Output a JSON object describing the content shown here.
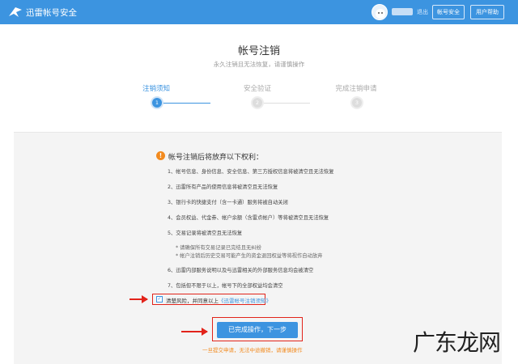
{
  "header": {
    "brand": "迅雷帐号安全",
    "username": "用户",
    "logout": "退出",
    "btn_security": "帐号安全",
    "btn_help": "用户帮助"
  },
  "page": {
    "title": "帐号注销",
    "subtitle": "永久注销且无法恢复，请谨慎操作"
  },
  "steps": [
    {
      "label": "注销须知",
      "num": "1"
    },
    {
      "label": "安全验证",
      "num": "2"
    },
    {
      "label": "完成注销申请",
      "num": "3"
    }
  ],
  "warning": {
    "icon": "!",
    "title": "帐号注销后将放弃以下权利："
  },
  "items": [
    "1、帐号信息、身份信息、安全信息、第三方授权信息将被清空且无法恢复",
    "2、迅雷所有产品的使用信息将被清空且无法恢复",
    "3、银行卡的快捷支付（含一卡通）服务将被自动关闭",
    "4、会员权益、代金券、帐户余额（含雷点帐户）等将被清空且无法恢复",
    "5、交易记录将被清空且无法恢复",
    "6、迅雷内部服务说明以及与迅雷相关的外部服务信息均会被清空",
    "7、包括但不限于以上，帐号下的全部权益均会清空"
  ],
  "notes": [
    "* 请确保所有交易记录已完结且无纠纷",
    "* 帐户注销后历史交易可能产生的资金退回权益等将视作自动放弃"
  ],
  "agreement": {
    "check": "✓",
    "text": "清楚风险，并同意以上",
    "link": "《迅雷帐号注销须知》"
  },
  "action": {
    "button": "已完成操作，下一步",
    "warning": "一旦提交申请，无法中途撤销，请谨慎操作"
  },
  "watermark": "广东龙网",
  "colors": {
    "primary": "#3c94e0",
    "warning": "#f28a1e",
    "highlight": "#e2231a"
  }
}
